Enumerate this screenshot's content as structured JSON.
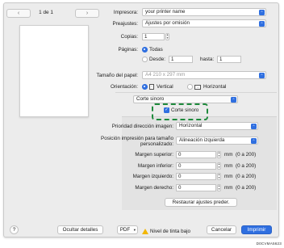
{
  "nav": {
    "prev": "‹",
    "next": "›",
    "page_position": "1 de 1"
  },
  "printer": {
    "label": "Impresora:",
    "value": "your printer name"
  },
  "presets": {
    "label": "Preajustes:",
    "value": "Ajustes por omisión"
  },
  "copies": {
    "label": "Copias:",
    "value": "1"
  },
  "pages": {
    "label": "Páginas:",
    "all": "Todas",
    "from_label": "Desde:",
    "from_value": "1",
    "to_label": "hasta:",
    "to_value": "1"
  },
  "paper_size": {
    "label": "Tamaño del papel:",
    "value": "A4  210 x 297 mm"
  },
  "orientation": {
    "label": "Orientación:",
    "vertical": "Vertical",
    "horizontal": "Horizontal"
  },
  "section_popup": {
    "value": "Corte sinoro"
  },
  "cut_checkbox": {
    "label": "Corte sinoro",
    "checked": true
  },
  "image_direction": {
    "label": "Prioridad dirección imagen:",
    "value": "Horizontal"
  },
  "print_position": {
    "label_line1": "Posición impresión para tamaño",
    "label_line2": "personalizado:",
    "value": "Alineación izquierda"
  },
  "margins": [
    {
      "label": "Margen superior:",
      "value": "0",
      "unit": "mm",
      "range": "(0 a 200)"
    },
    {
      "label": "Margen inferior:",
      "value": "0",
      "unit": "mm",
      "range": "(0 a 200)"
    },
    {
      "label": "Margen izquierdo:",
      "value": "0",
      "unit": "mm",
      "range": "(0 a 200)"
    },
    {
      "label": "Margen derecho:",
      "value": "0",
      "unit": "mm",
      "range": "(0 a 200)"
    }
  ],
  "restore_button": "Restaurar ajustes preder.",
  "bottom": {
    "help": "?",
    "hide_details": "Ocultar detalles",
    "pdf": "PDF",
    "ink_warning": "Nivel de tinta bajo",
    "cancel": "Cancelar",
    "print": "Imprimir"
  },
  "figure_code": "D0CVMA5623",
  "colors": {
    "accent": "#2f6fe0",
    "highlight_dash": "#1e8a3c",
    "warning": "#f2b600"
  }
}
